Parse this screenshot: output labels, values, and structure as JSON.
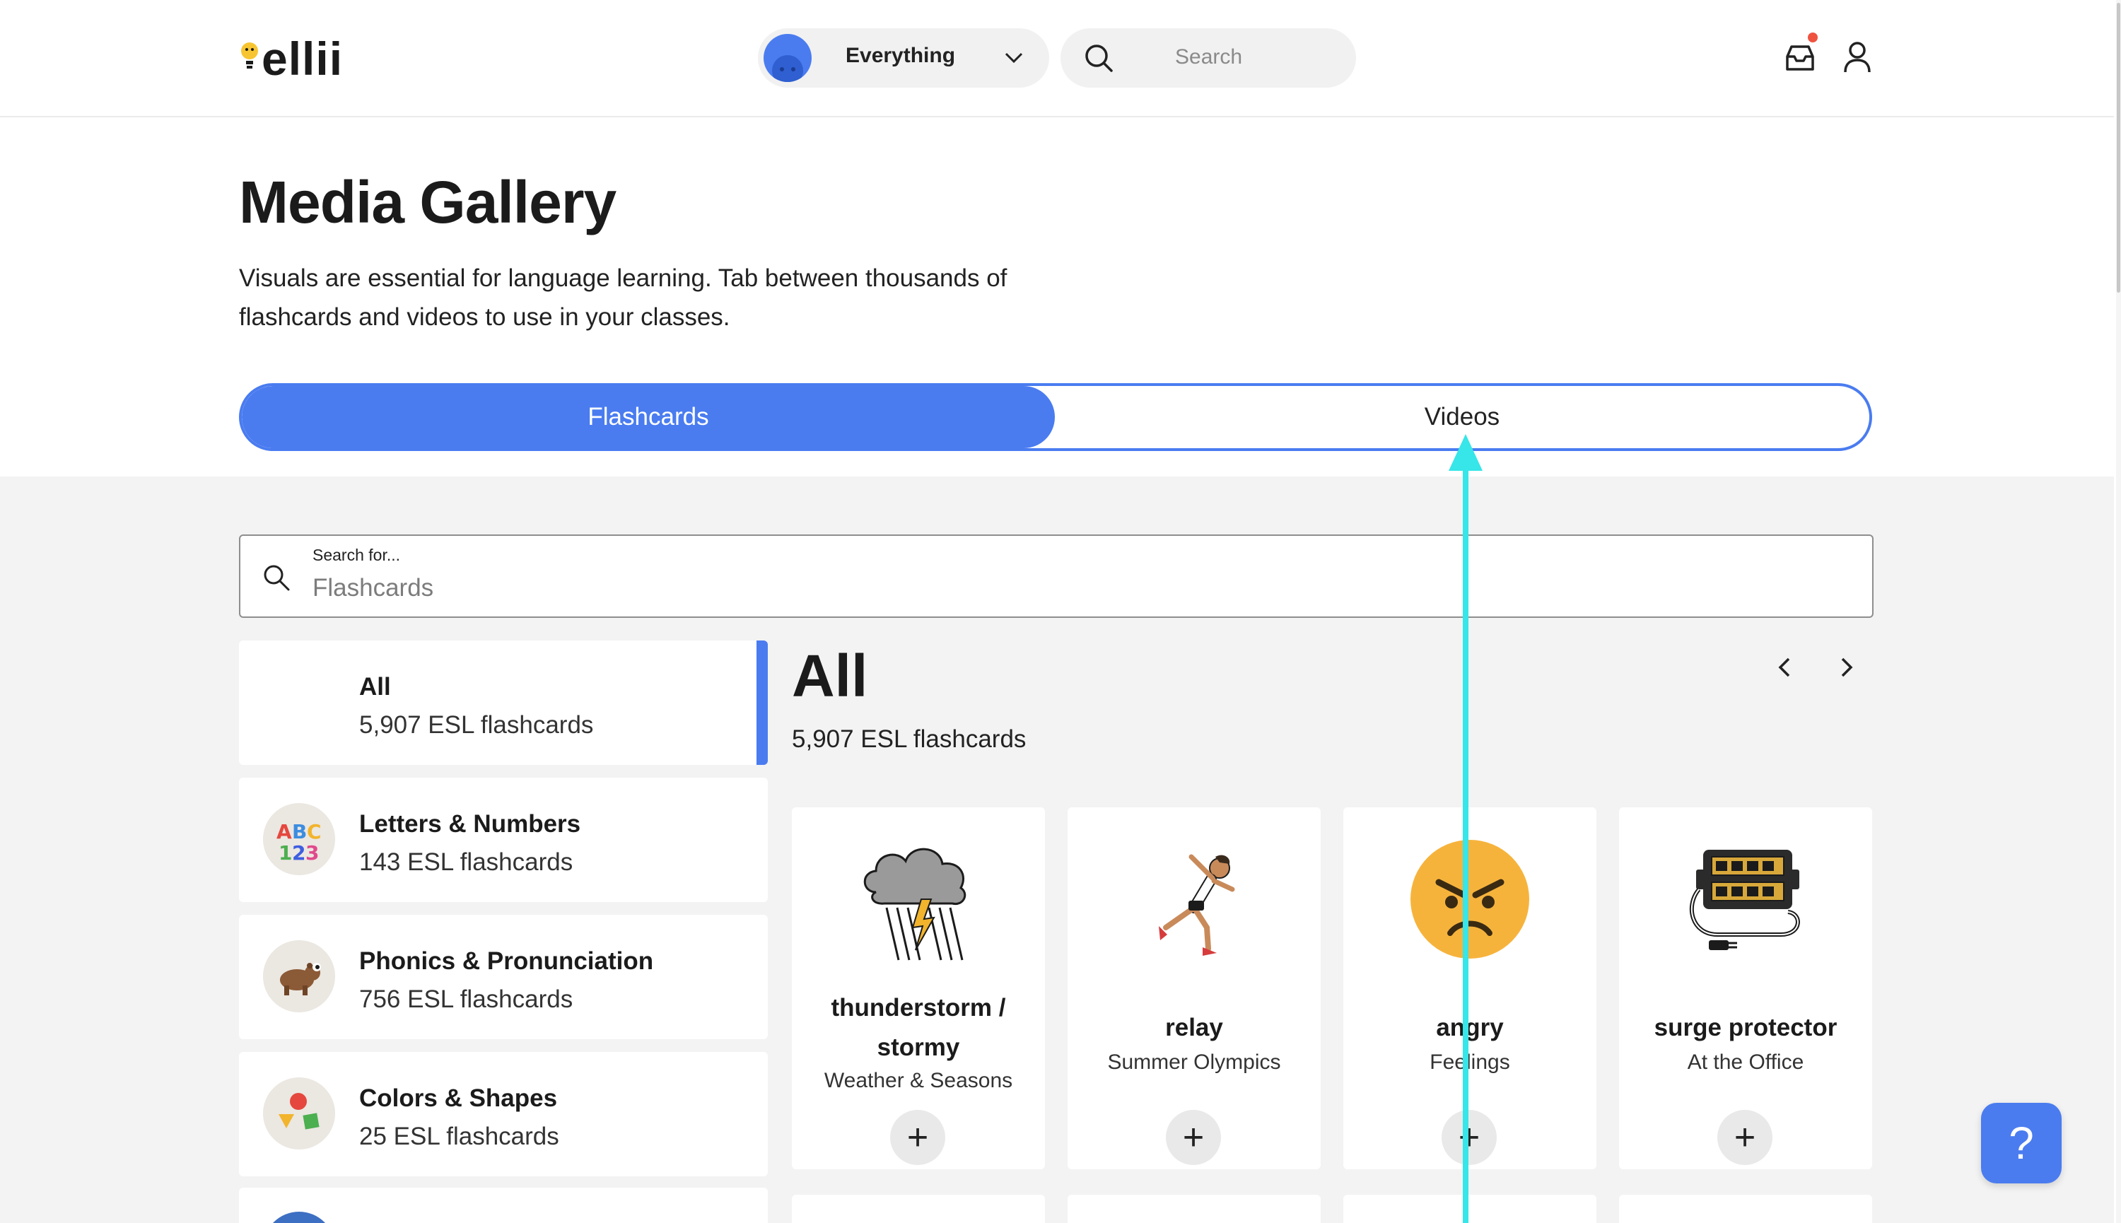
{
  "header": {
    "logo_text": "ellii",
    "scope_label": "Everything",
    "search_placeholder": "Search"
  },
  "intro": {
    "title": "Media Gallery",
    "description": "Visuals are essential for language learning. Tab between thousands of flashcards and videos to use in your classes."
  },
  "tabs": [
    {
      "label": "Flashcards",
      "active": true
    },
    {
      "label": "Videos",
      "active": false
    }
  ],
  "flashcard_search": {
    "label": "Search for...",
    "placeholder": "Flashcards"
  },
  "categories": [
    {
      "name": "All",
      "count": "5,907 ESL flashcards",
      "selected": true
    },
    {
      "name": "Letters & Numbers",
      "count": "143 ESL flashcards",
      "icon": "abc-123-icon"
    },
    {
      "name": "Phonics & Pronunciation",
      "count": "756 ESL flashcards",
      "icon": "bear-icon"
    },
    {
      "name": "Colors & Shapes",
      "count": "25 ESL flashcards",
      "icon": "shapes-icon"
    }
  ],
  "main": {
    "title": "All",
    "count": "5,907 ESL flashcards"
  },
  "cards": [
    {
      "name": "thunderstorm / stormy",
      "category": "Weather & Seasons",
      "icon": "thunderstorm-icon"
    },
    {
      "name": "relay",
      "category": "Summer Olympics",
      "icon": "runner-icon"
    },
    {
      "name": "angry",
      "category": "Feelings",
      "icon": "angry-face-icon"
    },
    {
      "name": "surge protector",
      "category": "At the Office",
      "icon": "power-strip-icon"
    }
  ],
  "help_label": "?",
  "colors": {
    "accent": "#4a7cf0",
    "cursor": "#36e6e8",
    "notification": "#ef5340"
  }
}
